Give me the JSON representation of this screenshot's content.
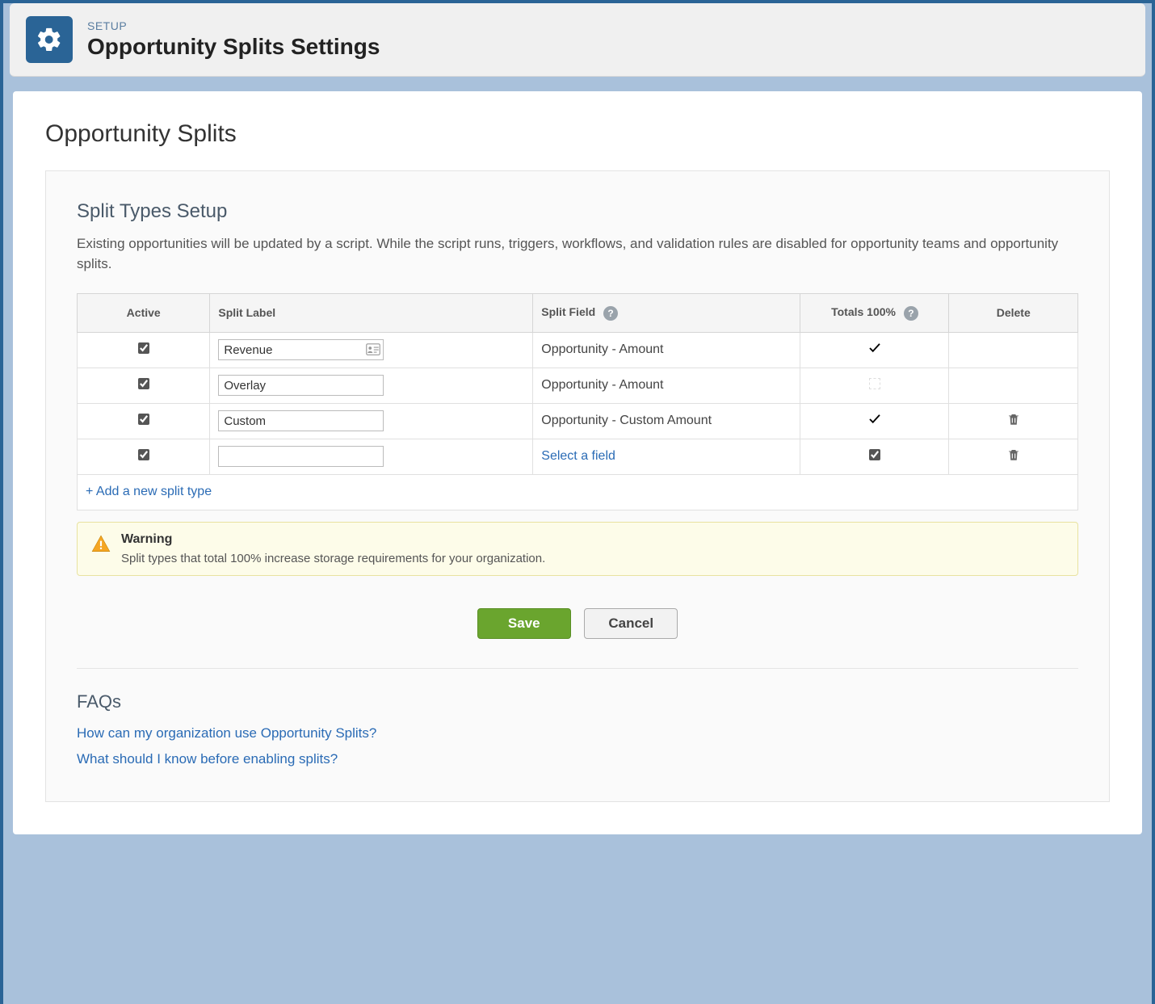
{
  "header": {
    "breadcrumb": "SETUP",
    "title": "Opportunity Splits Settings"
  },
  "page": {
    "title": "Opportunity Splits"
  },
  "section": {
    "title": "Split Types Setup",
    "desc": "Existing opportunities will be updated by a script. While the script runs, triggers, workflows, and validation rules are disabled for opportunity teams and opportunity splits."
  },
  "table": {
    "columns": {
      "active": "Active",
      "label": "Split Label",
      "field": "Split Field",
      "totals": "Totals 100%",
      "delete": "Delete"
    },
    "rows": [
      {
        "active": true,
        "label": "Revenue",
        "hasLabelIcon": true,
        "field": "Opportunity - Amount",
        "fieldIsLink": false,
        "totals": "checkmark",
        "deletable": false
      },
      {
        "active": true,
        "label": "Overlay",
        "hasLabelIcon": false,
        "field": "Opportunity - Amount",
        "fieldIsLink": false,
        "totals": "empty",
        "deletable": false
      },
      {
        "active": true,
        "label": "Custom",
        "hasLabelIcon": false,
        "field": "Opportunity - Custom Amount",
        "fieldIsLink": false,
        "totals": "checkmark",
        "deletable": true
      },
      {
        "active": true,
        "label": "",
        "hasLabelIcon": false,
        "field": "Select a field",
        "fieldIsLink": true,
        "totals": "checkbox",
        "deletable": true
      }
    ],
    "addLabel": "+ Add a new split type"
  },
  "warning": {
    "title": "Warning",
    "message": "Split types that total 100% increase storage requirements for your organization."
  },
  "buttons": {
    "save": "Save",
    "cancel": "Cancel"
  },
  "faqs": {
    "title": "FAQs",
    "links": [
      "How can my organization use Opportunity Splits?",
      "What should I know before enabling splits?"
    ]
  }
}
